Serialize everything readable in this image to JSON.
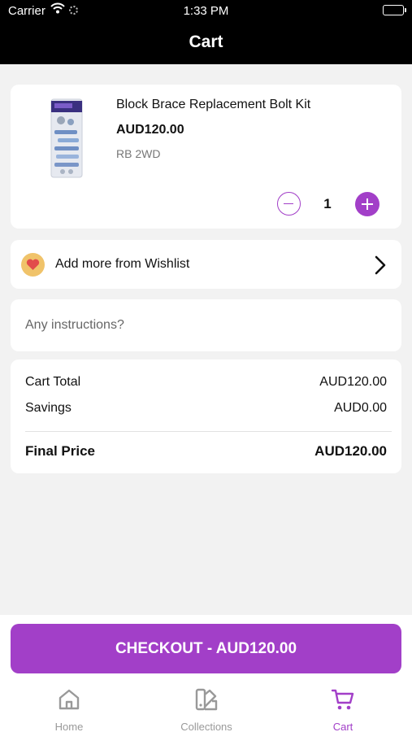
{
  "status_bar": {
    "carrier": "Carrier",
    "time": "1:33 PM"
  },
  "nav": {
    "title": "Cart"
  },
  "cart_item": {
    "name": "Block Brace Replacement Bolt Kit",
    "price": "AUD120.00",
    "variant": "RB 2WD",
    "quantity": "1"
  },
  "wishlist": {
    "label": "Add more from Wishlist"
  },
  "instructions": {
    "placeholder": "Any instructions?"
  },
  "summary": {
    "cart_total_label": "Cart Total",
    "cart_total_value": "AUD120.00",
    "savings_label": "Savings",
    "savings_value": "AUD0.00",
    "final_label": "Final Price",
    "final_value": "AUD120.00"
  },
  "checkout": {
    "label": "CHECKOUT - AUD120.00"
  },
  "tabs": [
    {
      "label": "Home",
      "icon": "home-icon",
      "active": false
    },
    {
      "label": "Collections",
      "icon": "collections-icon",
      "active": false
    },
    {
      "label": "Cart",
      "icon": "cart-icon",
      "active": true
    }
  ],
  "colors": {
    "accent": "#a23fc8",
    "nav_bg": "#000000",
    "page_bg": "#f2f2f2"
  }
}
